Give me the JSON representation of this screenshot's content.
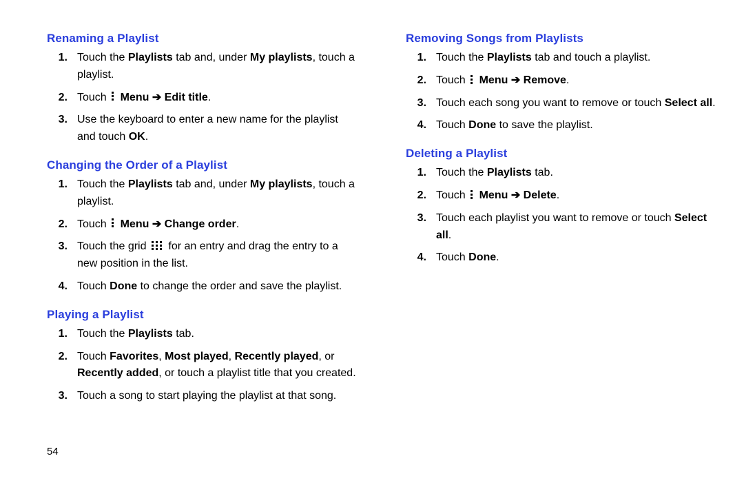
{
  "page_number": "54",
  "left": {
    "section1": {
      "heading": "Renaming a Playlist",
      "s1a": "Touch the ",
      "s1b": "Playlists",
      "s1c": " tab and, under ",
      "s1d": "My playlists",
      "s1e": ", touch a playlist.",
      "s2a": "Touch ",
      "s2menu": "Menu",
      "s2arrow": " ➔ ",
      "s2cmd": "Edit title",
      "s2end": ".",
      "s3a": "Use the keyboard to enter a new name for the playlist and touch ",
      "s3b": "OK",
      "s3c": "."
    },
    "section2": {
      "heading": "Changing the Order of a Playlist",
      "s1a": "Touch the ",
      "s1b": "Playlists",
      "s1c": " tab and, under ",
      "s1d": "My playlists",
      "s1e": ", touch a playlist.",
      "s2a": "Touch ",
      "s2menu": "Menu",
      "s2arrow": " ➔ ",
      "s2cmd": "Change order",
      "s2end": ".",
      "s3a": "Touch the grid ",
      "s3b": " for an entry and drag the entry to a new position in the list.",
      "s4a": "Touch ",
      "s4b": "Done",
      "s4c": " to change the order and save the playlist."
    },
    "section3": {
      "heading": "Playing a Playlist",
      "s1a": "Touch the ",
      "s1b": "Playlists",
      "s1c": " tab.",
      "s2a": "Touch ",
      "s2b": "Favorites",
      "s2c": ", ",
      "s2d": "Most played",
      "s2e": ", ",
      "s2f": "Recently played",
      "s2g": ", or ",
      "s2h": "Recently added",
      "s2i": ", or touch a playlist title that you created.",
      "s3a": "Touch a song to start playing the playlist at that song."
    }
  },
  "right": {
    "section1": {
      "heading": "Removing Songs from Playlists",
      "s1a": "Touch the ",
      "s1b": "Playlists",
      "s1c": " tab and touch a playlist.",
      "s2a": "Touch ",
      "s2menu": "Menu",
      "s2arrow": " ➔ ",
      "s2cmd": "Remove",
      "s2end": ".",
      "s3a": "Touch each song you want to remove or touch ",
      "s3b": "Select all",
      "s3c": ".",
      "s4a": "Touch ",
      "s4b": "Done",
      "s4c": " to save the playlist."
    },
    "section2": {
      "heading": "Deleting a Playlist",
      "s1a": "Touch the ",
      "s1b": "Playlists",
      "s1c": " tab.",
      "s2a": "Touch ",
      "s2menu": "Menu",
      "s2arrow": " ➔ ",
      "s2cmd": "Delete",
      "s2end": ".",
      "s3a": "Touch each playlist you want to remove or touch ",
      "s3b": "Select all",
      "s3c": ".",
      "s4a": "Touch ",
      "s4b": "Done",
      "s4c": "."
    }
  }
}
